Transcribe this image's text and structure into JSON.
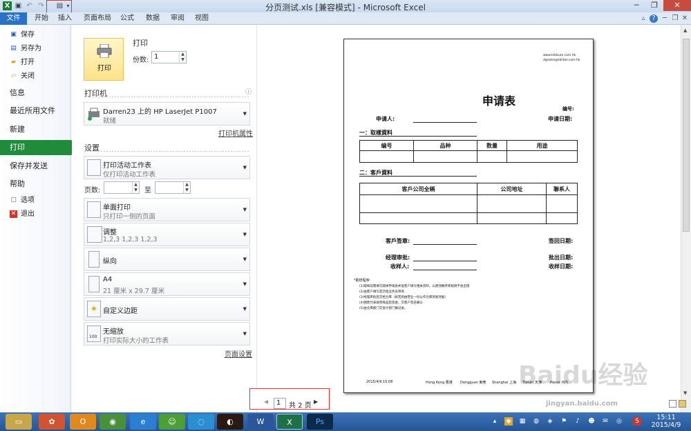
{
  "window": {
    "title": "分页测试.xls  [兼容模式] - Microsoft Excel",
    "quick_access": [
      "excel-logo-icon",
      "save-icon",
      "undo-icon",
      "redo-icon",
      "print-preview-icon",
      "customize-icon"
    ]
  },
  "ribbon": {
    "tabs": [
      "文件",
      "开始",
      "插入",
      "页面布局",
      "公式",
      "数据",
      "审阅",
      "视图"
    ]
  },
  "sidebar": {
    "top_items": [
      {
        "label": "保存",
        "icon": "save-icon"
      },
      {
        "label": "另存为",
        "icon": "save-as-icon"
      },
      {
        "label": "打开",
        "icon": "open-folder-icon"
      },
      {
        "label": "关闭",
        "icon": "close-file-icon"
      }
    ],
    "main_items": [
      "信息",
      "最近所用文件",
      "新建",
      "打印",
      "保存并发送",
      "帮助"
    ],
    "bottom_items": [
      {
        "label": "选项",
        "icon": "options-icon"
      },
      {
        "label": "退出",
        "icon": "exit-icon"
      }
    ]
  },
  "print_panel": {
    "title": "打印",
    "button_label": "打印",
    "copies_label": "份数:",
    "copies_value": "1",
    "printer_heading": "打印机",
    "printer_name": "Darren23 上的 HP LaserJet P1007",
    "printer_status": "就绪",
    "printer_properties": "打印机属性",
    "settings_heading": "设置",
    "options": [
      {
        "title": "打印活动工作表",
        "sub": "仅打印活动工作表"
      },
      {
        "title": "单面打印",
        "sub": "只打印一侧的页面"
      },
      {
        "title": "调整",
        "sub": "1,2,3    1,2,3    1,2,3"
      },
      {
        "title": "纵向",
        "sub": ""
      },
      {
        "title": "A4",
        "sub": "21 厘米 x 29.7 厘米"
      },
      {
        "title": "自定义边距",
        "sub": ""
      },
      {
        "title": "无缩放",
        "sub": "打印实际大小的工作表"
      }
    ],
    "pages_label": "页数:",
    "to_label": "至",
    "page_setup": "页面设置"
  },
  "preview": {
    "web": "www.tdcbum.com.hk",
    "email": "dgsales@tdcbel.com.hk",
    "form_title": "申请表",
    "number_label": "编号:",
    "applicant_label": "申请人:",
    "apply_date_label": "申请日期:",
    "section1": "一：取樣資料",
    "table1_headers": [
      "编号",
      "品种",
      "数量",
      "用途"
    ],
    "section2": "二：客戶資料",
    "table2_headers": [
      "客戶公司全稱",
      "公司地址",
      "聯系人"
    ],
    "customer_sign": "客戶签章:",
    "sign_date": "签回日期:",
    "manager_approve": "经理审批:",
    "approve_date": "批出日期:",
    "receiver": "收样人:",
    "receive_date": "收样日期:",
    "notes_title": "*取样程序：",
    "notes": [
      "(1)取样前需填写取样申请表并盖客户填写相关资料，以便须数所寄规则不会出错",
      "(2)由客户填写后交给业务员审阅",
      "(3)经理审批后交给仓库（如无则由营业一份以作仓库领发凭据）",
      "(4)销售代表收到样品后签收，交客户签名确认",
      "(5)由仓库部门交会计部门做记录。"
    ],
    "footer_date": "2015/4/9 15:08",
    "footer_items": [
      "Hong Kong 香港",
      "Dongguan 東莞",
      "Shanghai 上海",
      "Tianjin 天津",
      "Hanoi 河内"
    ]
  },
  "pager": {
    "current": "1",
    "total_label": "共 2 页"
  },
  "taskbar": {
    "time": "15:11",
    "date": "2015/4/9"
  },
  "watermark": {
    "brand": "Baidu经验",
    "url": "jingyan.baidu.com"
  },
  "colors": {
    "file_tab": "#2a72c5",
    "print_selected": "#1e8c3a",
    "print_button": "#ffe38a",
    "annotation": "#e03030",
    "taskbar": "#2f66a8"
  }
}
